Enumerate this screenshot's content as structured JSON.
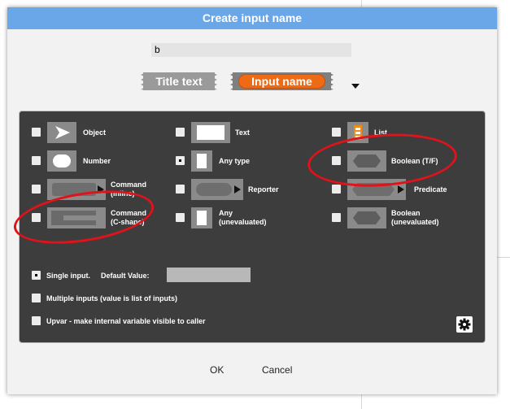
{
  "dialog": {
    "title": "Create input name",
    "name_value": "b",
    "tabs": {
      "title_text": "Title text",
      "input_name": "Input name"
    },
    "ok_label": "OK",
    "cancel_label": "Cancel"
  },
  "types": {
    "object": "Object",
    "text": "Text",
    "list": "List",
    "number": "Number",
    "any_type": "Any type",
    "boolean": "Boolean (T/F)",
    "command_inline_1": "Command",
    "command_inline_2": "(inline)",
    "reporter": "Reporter",
    "predicate": "Predicate",
    "command_c_1": "Command",
    "command_c_2": "(C-shape)",
    "any_uneval_1": "Any",
    "any_uneval_2": "(unevaluated)",
    "bool_uneval_1": "Boolean",
    "bool_uneval_2": "(unevaluated)",
    "selected": "any_type"
  },
  "slot_mode": {
    "single_label": "Single input.",
    "default_value_label": "Default Value:",
    "default_value": "",
    "multiple_label": "Multiple inputs (value is list of inputs)",
    "upvar_label": "Upvar - make internal variable visible to caller",
    "selected": "single"
  },
  "colors": {
    "title_bar": "#6aa7e8",
    "panel": "#3d3d3d",
    "input_name_pill": "#ee6a14",
    "annotation": "#e0121a"
  }
}
